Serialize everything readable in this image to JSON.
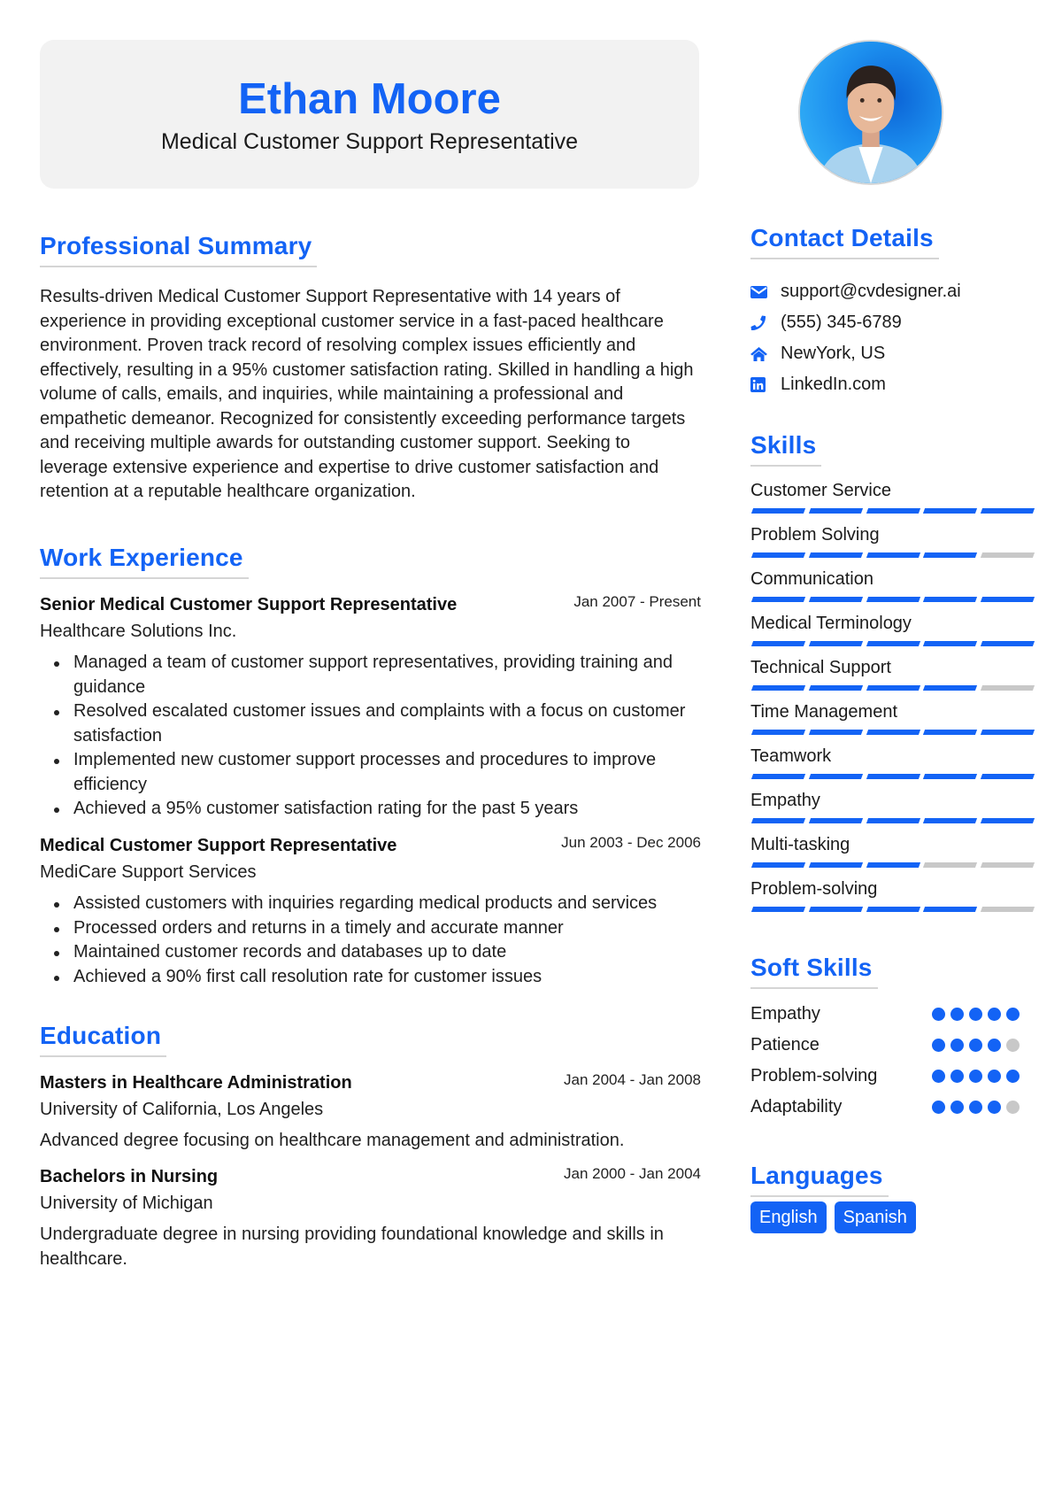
{
  "header": {
    "name": "Ethan Moore",
    "title": "Medical Customer Support Representative"
  },
  "colors": {
    "accent": "#1363f5",
    "header_bg": "#f2f2f2",
    "inactive": "#c8c8c8",
    "divider": "#d5d5d5"
  },
  "summary": {
    "heading": "Professional Summary",
    "text": "Results-driven Medical Customer Support Representative with 14 years of experience in providing exceptional customer service in a fast-paced healthcare environment. Proven track record of resolving complex issues efficiently and effectively, resulting in a 95% customer satisfaction rating. Skilled in handling a high volume of calls, emails, and inquiries, while maintaining a professional and empathetic demeanor. Recognized for consistently exceeding performance targets and receiving multiple awards for outstanding customer support. Seeking to leverage extensive experience and expertise to drive customer satisfaction and retention at a reputable healthcare organization."
  },
  "experience": {
    "heading": "Work Experience",
    "jobs": [
      {
        "title": "Senior Medical Customer Support Representative",
        "company": "Healthcare Solutions Inc.",
        "dates": "Jan 2007 - Present",
        "bullets": [
          "Managed a team of customer support representatives, providing training and guidance",
          "Resolved escalated customer issues and complaints with a focus on customer satisfaction",
          "Implemented new customer support processes and procedures to improve efficiency",
          "Achieved a 95% customer satisfaction rating for the past 5 years"
        ]
      },
      {
        "title": "Medical Customer Support Representative",
        "company": "MediCare Support Services",
        "dates": "Jun 2003 - Dec 2006",
        "bullets": [
          "Assisted customers with inquiries regarding medical products and services",
          "Processed orders and returns in a timely and accurate manner",
          "Maintained customer records and databases up to date",
          "Achieved a 90% first call resolution rate for customer issues"
        ]
      }
    ]
  },
  "education": {
    "heading": "Education",
    "items": [
      {
        "degree": "Masters in Healthcare Administration",
        "school": "University of California, Los Angeles",
        "dates": "Jan 2004 - Jan 2008",
        "description": "Advanced degree focusing on healthcare management and administration."
      },
      {
        "degree": "Bachelors in Nursing",
        "school": "University of Michigan",
        "dates": "Jan 2000 - Jan 2004",
        "description": "Undergraduate degree in nursing providing foundational knowledge and skills in healthcare."
      }
    ]
  },
  "contact": {
    "heading": "Contact Details",
    "items": [
      {
        "icon": "envelope-icon",
        "text": "support@cvdesigner.ai"
      },
      {
        "icon": "phone-icon",
        "text": "(555) 345-6789"
      },
      {
        "icon": "home-icon",
        "text": "NewYork, US"
      },
      {
        "icon": "linkedin-icon",
        "text": "LinkedIn.com"
      }
    ]
  },
  "skills": {
    "heading": "Skills",
    "max": 5,
    "items": [
      {
        "name": "Customer Service",
        "level": 5
      },
      {
        "name": "Problem Solving",
        "level": 4
      },
      {
        "name": "Communication",
        "level": 5
      },
      {
        "name": "Medical Terminology",
        "level": 5
      },
      {
        "name": "Technical Support",
        "level": 4
      },
      {
        "name": "Time Management",
        "level": 5
      },
      {
        "name": "Teamwork",
        "level": 5
      },
      {
        "name": "Empathy",
        "level": 5
      },
      {
        "name": "Multi-tasking",
        "level": 3
      },
      {
        "name": "Problem-solving",
        "level": 4
      }
    ]
  },
  "soft_skills": {
    "heading": "Soft Skills",
    "max": 5,
    "items": [
      {
        "name": "Empathy",
        "level": 5
      },
      {
        "name": "Patience",
        "level": 4
      },
      {
        "name": "Problem-solving",
        "level": 5
      },
      {
        "name": "Adaptability",
        "level": 4
      }
    ]
  },
  "languages": {
    "heading": "Languages",
    "items": [
      "English",
      "Spanish"
    ]
  }
}
